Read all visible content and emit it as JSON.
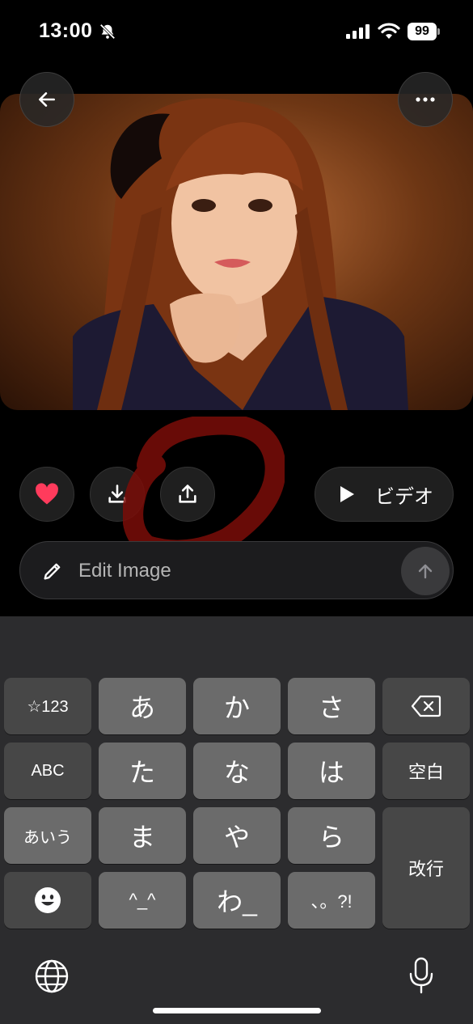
{
  "status_bar": {
    "time": "13:00",
    "battery": "99",
    "icons": [
      "bell-slash-icon",
      "signal-icon",
      "wifi-icon",
      "battery-icon"
    ]
  },
  "image": {
    "description_icon": "portrait-image"
  },
  "header": {
    "back_icon": "arrow-left-icon",
    "more_icon": "ellipsis-icon"
  },
  "actions": {
    "like_icon": "heart-icon",
    "download_icon": "download-icon",
    "share_icon": "share-icon",
    "video_icon": "play-icon",
    "video_label": "ビデオ",
    "like_color": "#ff3b5c"
  },
  "edit": {
    "placeholder": "Edit Image",
    "pencil_icon": "pencil-icon",
    "send_icon": "arrow-up-icon"
  },
  "keyboard": {
    "rows": [
      [
        "☆123",
        "あ",
        "か",
        "さ",
        "⌫"
      ],
      [
        "ABC",
        "た",
        "な",
        "は",
        "空白"
      ],
      [
        "あいう",
        "ま",
        "や",
        "ら",
        "改行"
      ],
      [
        "😀",
        "^_^",
        "わ_",
        "、。?!"
      ]
    ],
    "delete_icon": "backspace-icon",
    "emoji_icon": "emoji-icon",
    "globe_icon": "globe-icon",
    "mic_icon": "microphone-icon"
  },
  "colors": {
    "annotation": "#8a0f0a",
    "keyboard_bg": "#2c2c2e"
  }
}
